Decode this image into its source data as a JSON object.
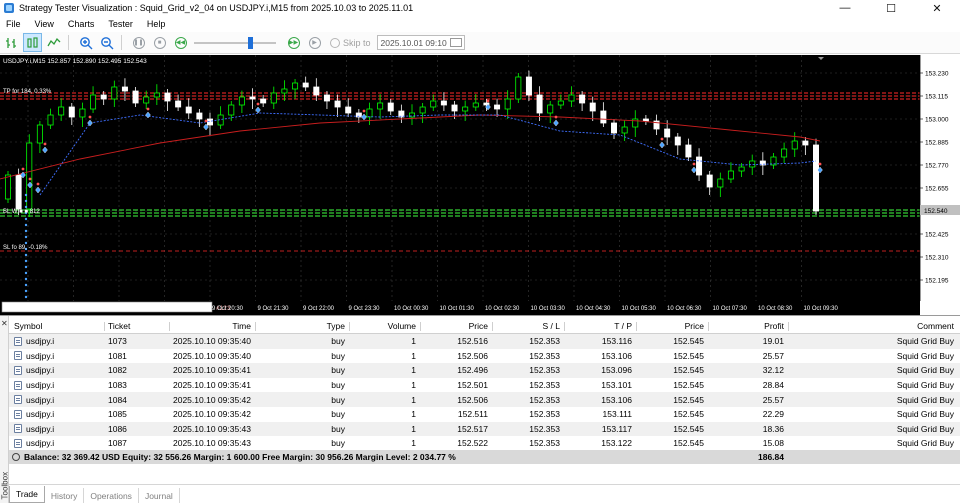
{
  "window": {
    "title": "Strategy Tester Visualization : Squid_Grid_v2_04 on USDJPY.i,M15 from 2025.10.03 to 2025.11.01",
    "minimize_glyph": "—",
    "maximize_glyph": "☐",
    "close_glyph": "✕"
  },
  "menu": [
    "File",
    "View",
    "Charts",
    "Tester",
    "Help"
  ],
  "toolbar": {
    "skip_label": "Skip to",
    "skip_date": "2025.10.01 09:10",
    "speed_fraction": 0.7
  },
  "chart": {
    "header": "USDJPY.i,M15   152.857  152.890  152.495  152.543",
    "price_labels": [
      "153.230",
      "153.115",
      "153.000",
      "152.885",
      "152.770",
      "152.655",
      "152.540",
      "152.425",
      "152.310",
      "152.195"
    ],
    "current_price": "152.540",
    "time_labels": [
      "9 Oct 20:30",
      "9 Oct 21:30",
      "9 Oct 22:00",
      "9 Oct 23:30",
      "10 Oct 00:30",
      "10 Oct 01:30",
      "10 Oct 02:30",
      "10 Oct 03:30",
      "10 Oct 04:30",
      "10 Oct 05:30",
      "10 Oct 06:30",
      "10 Oct 07:30",
      "10 Oct 08:30",
      "10 Oct 09:30"
    ],
    "sl_label": "SL  fo    89, -0.18%",
    "tp_label": "TP  for 184, 0.33%",
    "bl_label": "BL  W  ■ ■ 812",
    "ruler_label": "#123",
    "colors": {
      "background": "#000000",
      "grid": "#3c3c3c",
      "bull": "#00ff00",
      "bear": "#ffffff",
      "ma_red": "#c81e1e",
      "ma_blue": "#3f6fff",
      "entry_line": "#33cc33",
      "stop_line": "#ff2a2a"
    }
  },
  "table": {
    "columns": [
      "Symbol",
      "Ticket",
      "Time",
      "Type",
      "Volume",
      "Price",
      "S / L",
      "T / P",
      "Price",
      "Profit",
      "Comment"
    ],
    "rows": [
      [
        "usdjpy.i",
        "1073",
        "2025.10.10 09:35:40",
        "buy",
        "1",
        "152.516",
        "152.353",
        "153.116",
        "152.545",
        "19.01",
        "Squid Grid Buy"
      ],
      [
        "usdjpy.i",
        "1081",
        "2025.10.10 09:35:40",
        "buy",
        "1",
        "152.506",
        "152.353",
        "153.106",
        "152.545",
        "25.57",
        "Squid Grid Buy"
      ],
      [
        "usdjpy.i",
        "1082",
        "2025.10.10 09:35:41",
        "buy",
        "1",
        "152.496",
        "152.353",
        "153.096",
        "152.545",
        "32.12",
        "Squid Grid Buy"
      ],
      [
        "usdjpy.i",
        "1083",
        "2025.10.10 09:35:41",
        "buy",
        "1",
        "152.501",
        "152.353",
        "153.101",
        "152.545",
        "28.84",
        "Squid Grid Buy"
      ],
      [
        "usdjpy.i",
        "1084",
        "2025.10.10 09:35:42",
        "buy",
        "1",
        "152.506",
        "152.353",
        "153.106",
        "152.545",
        "25.57",
        "Squid Grid Buy"
      ],
      [
        "usdjpy.i",
        "1085",
        "2025.10.10 09:35:42",
        "buy",
        "1",
        "152.511",
        "152.353",
        "153.111",
        "152.545",
        "22.29",
        "Squid Grid Buy"
      ],
      [
        "usdjpy.i",
        "1086",
        "2025.10.10 09:35:43",
        "buy",
        "1",
        "152.517",
        "152.353",
        "153.117",
        "152.545",
        "18.36",
        "Squid Grid Buy"
      ],
      [
        "usdjpy.i",
        "1087",
        "2025.10.10 09:35:43",
        "buy",
        "1",
        "152.522",
        "152.353",
        "153.122",
        "152.545",
        "15.08",
        "Squid Grid Buy"
      ]
    ],
    "balance_text": "Balance: 32 369.42 USD  Equity: 32 556.26  Margin: 1 600.00  Free Margin: 30 956.26  Margin Level: 2 034.77 %",
    "total_profit": "186.84"
  },
  "toolbox": {
    "label": "Toolbox",
    "close_glyph": "✕",
    "tabs": [
      "Trade",
      "History",
      "Operations",
      "Journal"
    ],
    "active_tab": "Trade"
  }
}
